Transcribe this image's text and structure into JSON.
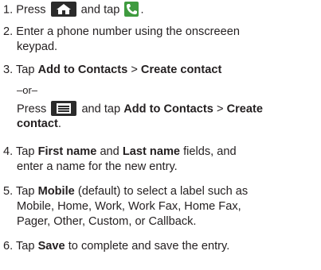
{
  "steps": [
    {
      "num": "1.",
      "pre": "Press",
      "mid": "and tap",
      "post": "."
    },
    {
      "num": "2.",
      "line1": "Enter a phone number using the onscreeen",
      "line2": "keypad."
    },
    {
      "num": "3.",
      "pre": "Tap",
      "b1": "Add to Contacts",
      "sep": ">",
      "b2": "Create contact",
      "or": "–or–",
      "press": "Press",
      "and_tap": "and tap",
      "b3": "Add to Contacts",
      "sep2": ">",
      "b4": "Create",
      "b5": "contact",
      "end": "."
    },
    {
      "num": "4.",
      "pre": "Tap",
      "b1": "First name",
      "and": "and",
      "b2": "Last name",
      "post": "fields, and",
      "line2": "enter a name for the new entry."
    },
    {
      "num": "5.",
      "pre": "Tap",
      "b1": "Mobile",
      "post": "(default) to select a label such as",
      "line2": "Mobile, Home, Work, Work Fax, Home Fax,",
      "line3": "Pager, Other, Custom, or Callback."
    },
    {
      "num": "6.",
      "pre": "Tap",
      "b1": "Save",
      "post": "to complete and save the entry."
    }
  ],
  "icons": {
    "home": "home-key-icon",
    "phone": "phone-icon",
    "menu": "menu-key-icon"
  }
}
